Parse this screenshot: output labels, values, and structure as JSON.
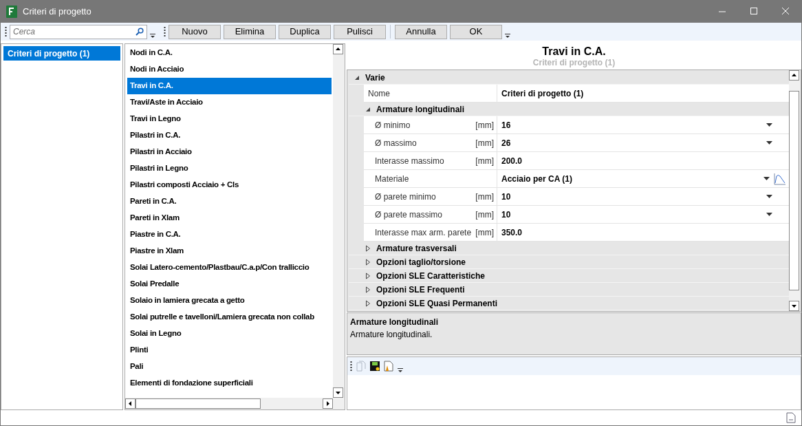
{
  "window": {
    "title": "Criteri di progetto"
  },
  "toolbar": {
    "search": {
      "placeholder": "Cerca"
    },
    "buttons": [
      "Nuovo",
      "Elimina",
      "Duplica",
      "Pulisci"
    ],
    "buttons_2": [
      "Annulla",
      "OK"
    ]
  },
  "sidebar": {
    "items": [
      {
        "label": "Criteri di progetto (1)",
        "selected": true
      }
    ]
  },
  "element_list": {
    "items": [
      {
        "label": "Nodi in C.A.",
        "selected": false
      },
      {
        "label": "Nodi in Acciaio",
        "selected": false
      },
      {
        "label": "Travi in C.A.",
        "selected": true
      },
      {
        "label": "Travi/Aste in Acciaio",
        "selected": false
      },
      {
        "label": "Travi in Legno",
        "selected": false
      },
      {
        "label": "Pilastri in C.A.",
        "selected": false
      },
      {
        "label": "Pilastri in Acciaio",
        "selected": false
      },
      {
        "label": "Pilastri in Legno",
        "selected": false
      },
      {
        "label": "Pilastri composti Acciaio + Cls",
        "selected": false
      },
      {
        "label": "Pareti in C.A.",
        "selected": false
      },
      {
        "label": "Pareti in Xlam",
        "selected": false
      },
      {
        "label": "Piastre in C.A.",
        "selected": false
      },
      {
        "label": "Piastre in Xlam",
        "selected": false
      },
      {
        "label": "Solai Latero-cemento/Plastbau/C.a.p/Con tralliccio",
        "selected": false
      },
      {
        "label": "Solai Predalle",
        "selected": false
      },
      {
        "label": "Solaio in lamiera grecata a getto",
        "selected": false
      },
      {
        "label": "Solai putrelle e tavelloni/Lamiera grecata non collab",
        "selected": false
      },
      {
        "label": "Solai in Legno",
        "selected": false
      },
      {
        "label": "Plinti",
        "selected": false
      },
      {
        "label": "Pali",
        "selected": false
      },
      {
        "label": "Elementi di fondazione superficiali",
        "selected": false
      }
    ]
  },
  "detail": {
    "title": "Travi in C.A.",
    "subtitle": "Criteri di progetto (1)",
    "categories": [
      {
        "label": "Varie",
        "expanded": true,
        "rows": [
          {
            "kind": "text",
            "name": "Nome",
            "value": "Criteri di progetto (1)"
          }
        ],
        "subcategories": [
          {
            "label": "Armature longitudinali",
            "expanded": true,
            "rows": [
              {
                "kind": "dropdown",
                "name": "Ø minimo",
                "unit": "[mm]",
                "value": "16"
              },
              {
                "kind": "dropdown",
                "name": "Ø massimo",
                "unit": "[mm]",
                "value": "26"
              },
              {
                "kind": "text",
                "name": "Interasse massimo",
                "unit": "[mm]",
                "value": "200.0"
              },
              {
                "kind": "material",
                "name": "Materiale",
                "value": "Acciaio per CA (1)"
              },
              {
                "kind": "dropdown",
                "name": "Ø parete minimo",
                "unit": "[mm]",
                "value": "10"
              },
              {
                "kind": "dropdown",
                "name": "Ø parete massimo",
                "unit": "[mm]",
                "value": "10"
              },
              {
                "kind": "text",
                "name": "Interasse max arm. parete",
                "unit": "[mm]",
                "value": "350.0"
              }
            ]
          },
          {
            "label": "Armature trasversali",
            "expanded": false
          },
          {
            "label": "Opzioni taglio/torsione",
            "expanded": false
          },
          {
            "label": "Opzioni SLE Caratteristiche",
            "expanded": false
          },
          {
            "label": "Opzioni SLE Frequenti",
            "expanded": false
          },
          {
            "label": "Opzioni SLE Quasi Permanenti",
            "expanded": false
          }
        ]
      }
    ]
  },
  "description": {
    "title": "Armature longitudinali",
    "text": "Armature longitudinali."
  }
}
